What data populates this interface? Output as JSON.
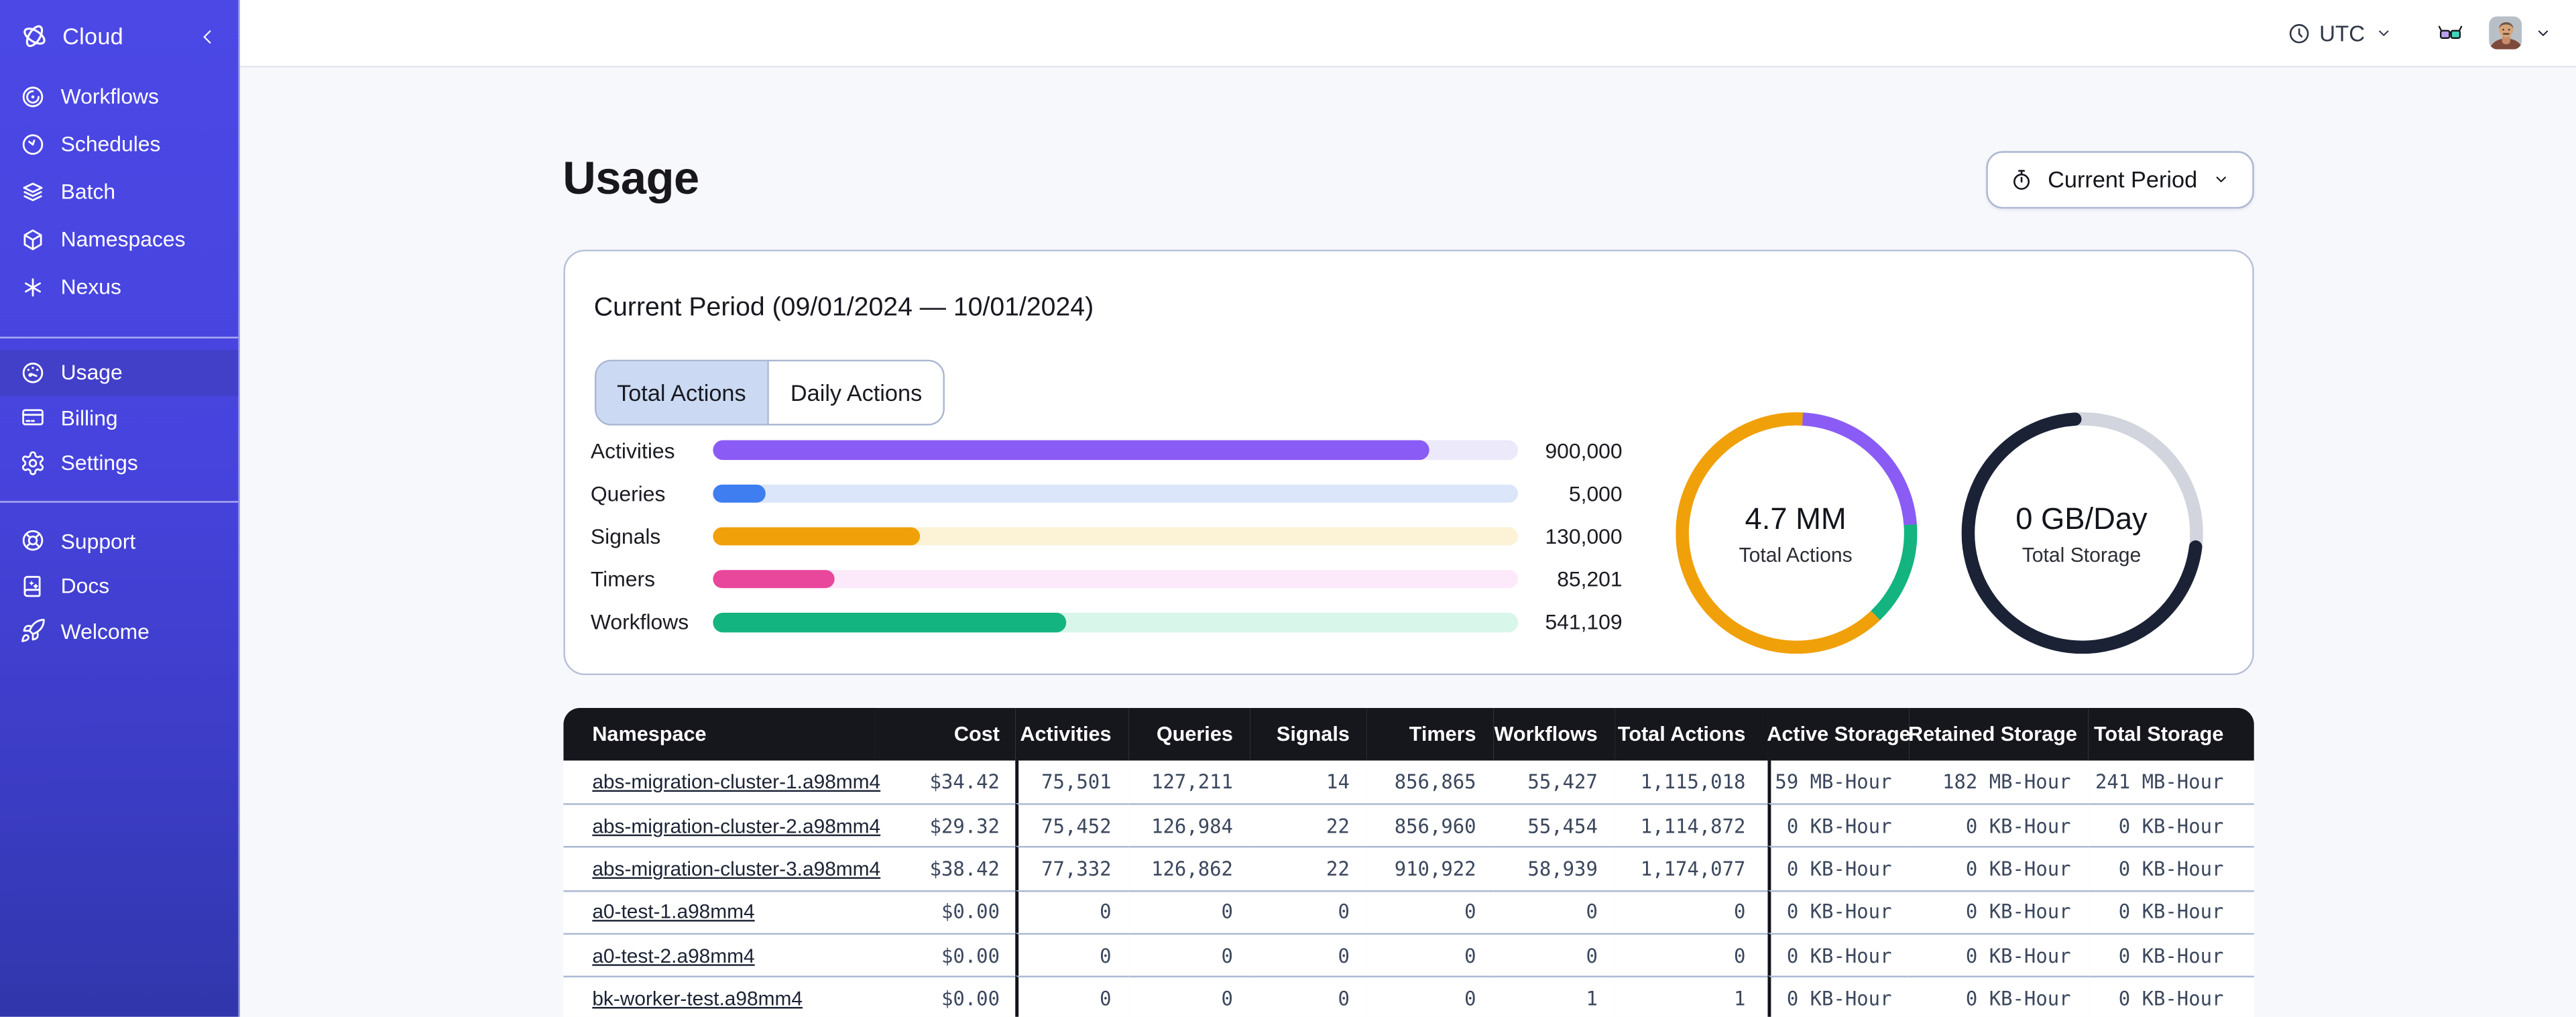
{
  "colors": {
    "sidebar_top": "#4b48e6",
    "sidebar_bottom": "#3136ab",
    "sidebar_active": "#423fc9",
    "table_header_bg": "#16161d",
    "tab_active_bg": "#cbd9f2",
    "card_border": "#b6c0d8"
  },
  "sidebar": {
    "brand": {
      "label": "Cloud",
      "logo": "temporal-logo-icon",
      "collapse": "chevron-left-icon"
    },
    "nav_main": [
      {
        "label": "Workflows",
        "icon": "workflows-icon",
        "active": false
      },
      {
        "label": "Schedules",
        "icon": "schedules-icon",
        "active": false
      },
      {
        "label": "Batch",
        "icon": "batch-icon",
        "active": false
      },
      {
        "label": "Namespaces",
        "icon": "namespaces-icon",
        "active": false
      },
      {
        "label": "Nexus",
        "icon": "nexus-icon",
        "active": false
      }
    ],
    "nav_account": [
      {
        "label": "Usage",
        "icon": "usage-icon",
        "active": true
      },
      {
        "label": "Billing",
        "icon": "billing-icon",
        "active": false
      },
      {
        "label": "Settings",
        "icon": "settings-icon",
        "active": false
      }
    ],
    "nav_footer": [
      {
        "label": "Support",
        "icon": "support-icon",
        "active": false
      },
      {
        "label": "Docs",
        "icon": "docs-icon",
        "active": false
      },
      {
        "label": "Welcome",
        "icon": "welcome-icon",
        "active": false
      }
    ]
  },
  "topbar": {
    "timezone": {
      "label": "UTC",
      "icon": "clock-icon",
      "caret": "chevron-down-icon"
    },
    "glasses": "glasses-icon",
    "avatar": "user-avatar"
  },
  "page": {
    "title": "Usage",
    "period_button": {
      "label": "Current Period",
      "icon": "stopwatch-icon",
      "caret": "chevron-down-icon"
    }
  },
  "usage_card": {
    "title": "Current Period (09/01/2024 — 10/01/2024)",
    "tabs": [
      {
        "label": "Total Actions",
        "active": true
      },
      {
        "label": "Daily Actions",
        "active": false
      }
    ]
  },
  "chart_data": [
    {
      "type": "bar",
      "orientation": "horizontal",
      "title": "",
      "categories": [
        "Activities",
        "Queries",
        "Signals",
        "Timers",
        "Workflows"
      ],
      "values": [
        900000,
        5000,
        130000,
        85201,
        541109
      ],
      "value_labels": [
        "900,000",
        "5,000",
        "130,000",
        "85,201",
        "541,109"
      ],
      "fill_fractions": [
        0.89,
        0.066,
        0.258,
        0.152,
        0.439
      ],
      "colors": [
        "#8a5cf5",
        "#3e7ef0",
        "#f0a009",
        "#e8479b",
        "#13b47f"
      ],
      "track_colors": [
        "#ece9fb",
        "#dbe6fa",
        "#fcf2d5",
        "#fce9fa",
        "#d8f6ea"
      ],
      "grid": false,
      "legend": "none"
    },
    {
      "type": "donut",
      "center_value": "4.7 MM",
      "center_label": "Total Actions",
      "start_angle_deg": 3,
      "segments": [
        {
          "color": "#8a5cf5",
          "percent": 23
        },
        {
          "color": "#13b47f",
          "percent": 14
        },
        {
          "color": "#f0a009",
          "percent": 63
        }
      ]
    },
    {
      "type": "donut",
      "center_value": "0 GB/Day",
      "center_label": "Total Storage",
      "start_angle_deg": 97,
      "track_color": "#d2d5dd",
      "segments": [
        {
          "color": "#1b2236",
          "percent": 72,
          "rounded": true
        }
      ]
    }
  ],
  "table": {
    "columns": [
      {
        "key": "namespace",
        "label": "Namespace"
      },
      {
        "key": "cost",
        "label": "Cost"
      },
      {
        "key": "activities",
        "label": "Activities"
      },
      {
        "key": "queries",
        "label": "Queries"
      },
      {
        "key": "signals",
        "label": "Signals"
      },
      {
        "key": "timers",
        "label": "Timers"
      },
      {
        "key": "workflows",
        "label": "Workflows"
      },
      {
        "key": "total_actions",
        "label": "Total Actions"
      },
      {
        "key": "active_storage",
        "label": "Active Storage"
      },
      {
        "key": "retained_storage",
        "label": "Retained Storage"
      },
      {
        "key": "total_storage",
        "label": "Total Storage"
      }
    ],
    "rows": [
      {
        "namespace": "abs-migration-cluster-1.a98mm4",
        "values": [
          "$34.42",
          "75,501",
          "127,211",
          "14",
          "856,865",
          "55,427",
          "1,115,018",
          "59 MB-Hour",
          "182 MB-Hour",
          "241 MB-Hour"
        ]
      },
      {
        "namespace": "abs-migration-cluster-2.a98mm4",
        "values": [
          "$29.32",
          "75,452",
          "126,984",
          "22",
          "856,960",
          "55,454",
          "1,114,872",
          "0 KB-Hour",
          "0 KB-Hour",
          "0 KB-Hour"
        ]
      },
      {
        "namespace": "abs-migration-cluster-3.a98mm4",
        "values": [
          "$38.42",
          "77,332",
          "126,862",
          "22",
          "910,922",
          "58,939",
          "1,174,077",
          "0 KB-Hour",
          "0 KB-Hour",
          "0 KB-Hour"
        ]
      },
      {
        "namespace": "a0-test-1.a98mm4",
        "values": [
          "$0.00",
          "0",
          "0",
          "0",
          "0",
          "0",
          "0",
          "0 KB-Hour",
          "0 KB-Hour",
          "0 KB-Hour"
        ]
      },
      {
        "namespace": "a0-test-2.a98mm4",
        "values": [
          "$0.00",
          "0",
          "0",
          "0",
          "0",
          "0",
          "0",
          "0 KB-Hour",
          "0 KB-Hour",
          "0 KB-Hour"
        ]
      },
      {
        "namespace": "bk-worker-test.a98mm4",
        "values": [
          "$0.00",
          "0",
          "0",
          "0",
          "0",
          "1",
          "1",
          "0 KB-Hour",
          "0 KB-Hour",
          "0 KB-Hour"
        ]
      }
    ]
  }
}
